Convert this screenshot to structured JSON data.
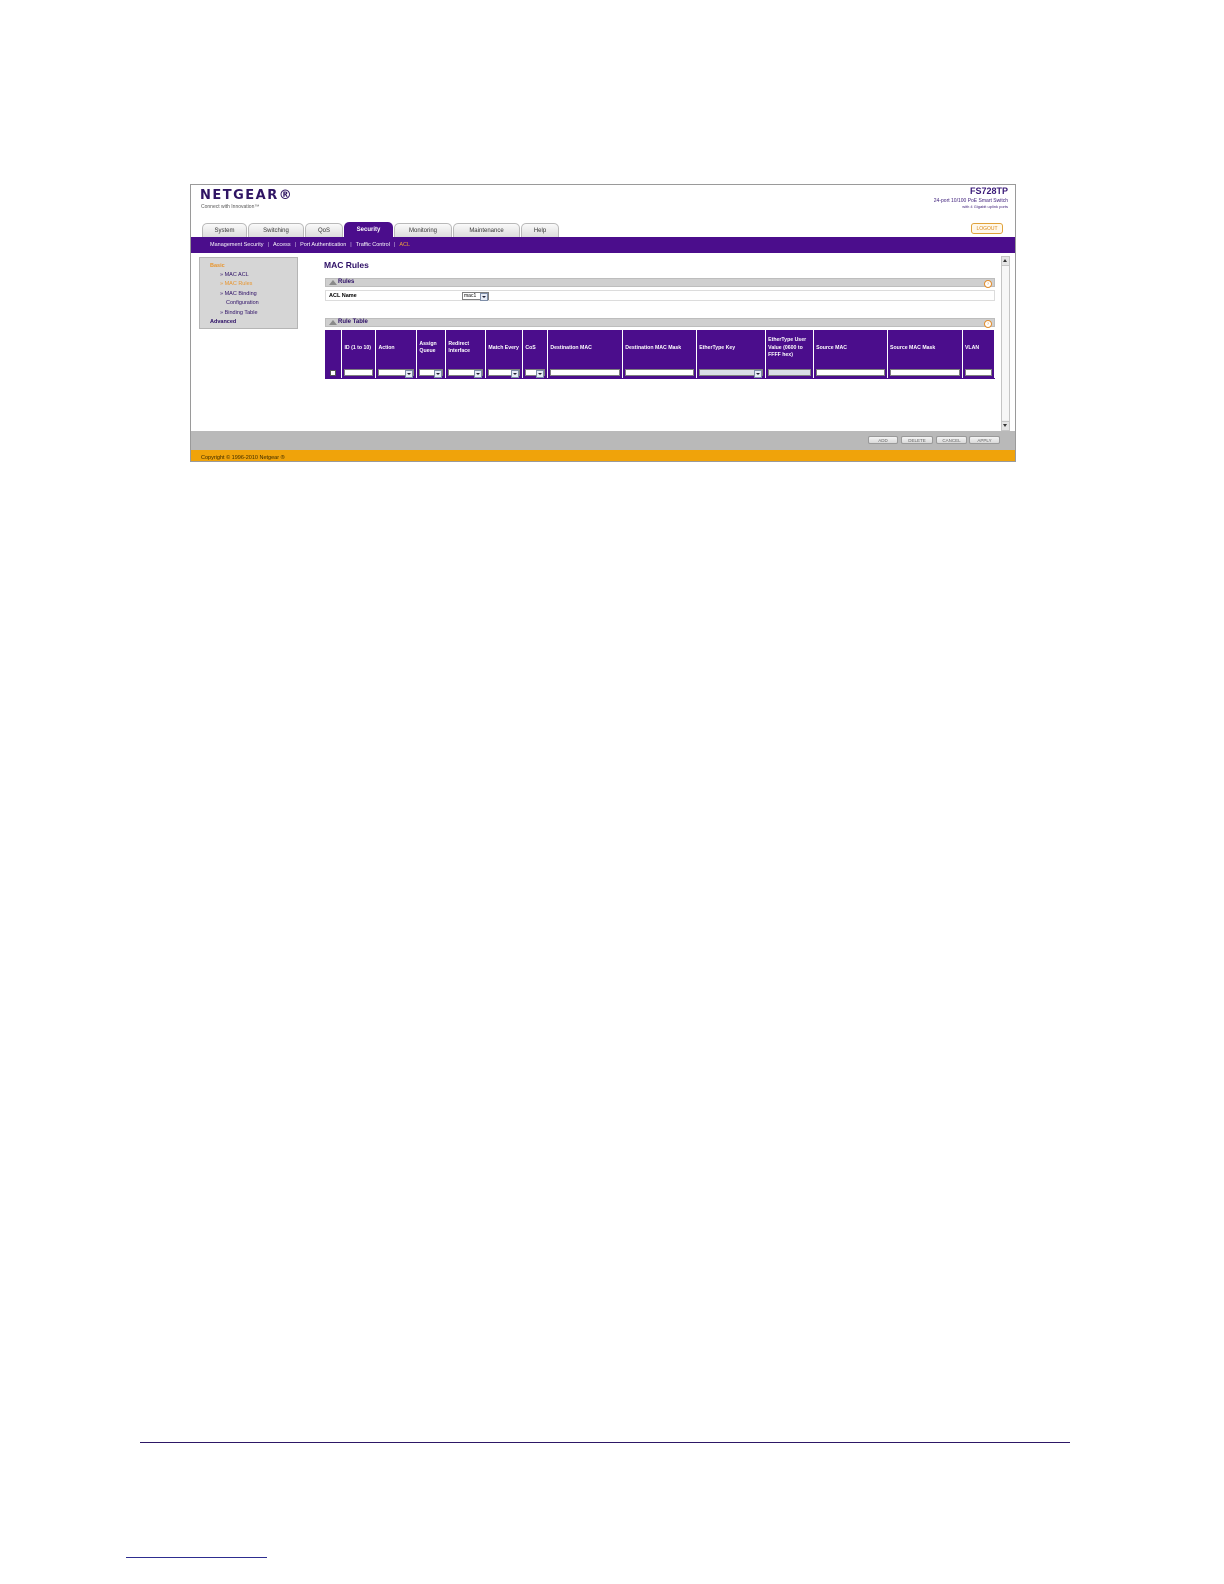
{
  "header": {
    "logo": "NETGEAR®",
    "tagline": "Connect with Innovation™",
    "model": "FS728TP",
    "model_desc_1": "24-port 10/100 PoE Smart Switch",
    "model_desc_2": "with 4 Gigabit uplink ports",
    "logout": "LOGOUT"
  },
  "tabs": [
    {
      "label": "System"
    },
    {
      "label": "Switching"
    },
    {
      "label": "QoS"
    },
    {
      "label": "Security",
      "active": true
    },
    {
      "label": "Monitoring"
    },
    {
      "label": "Maintenance"
    },
    {
      "label": "Help"
    }
  ],
  "subnav": [
    {
      "label": "Management Security"
    },
    {
      "label": "Access"
    },
    {
      "label": "Port Authentication"
    },
    {
      "label": "Traffic Control"
    },
    {
      "label": "ACL",
      "active": true
    }
  ],
  "leftnav": {
    "basic": "Basic",
    "mac_acl": "» MAC ACL",
    "mac_rules": "» MAC Rules",
    "mac_binding_1": "» MAC Binding",
    "mac_binding_2": "Configuration",
    "binding_table": "» Binding Table",
    "advanced": "Advanced"
  },
  "main": {
    "title": "MAC Rules",
    "rules_section": "Rules",
    "acl_name_label": "ACL Name",
    "acl_name_value": "mac1",
    "rule_table_section": "Rule Table"
  },
  "table": {
    "headers": [
      "",
      "ID (1 to 10)",
      "Action",
      "Assign Queue",
      "Redirect Interface",
      "Match Every",
      "CoS",
      "Destination MAC",
      "Destination MAC Mask",
      "EtherType Key",
      "EtherType User Value (0600 to FFFF hex)",
      "Source MAC",
      "Source MAC Mask",
      "VLAN"
    ]
  },
  "buttons": {
    "add": "ADD",
    "delete": "DELETE",
    "cancel": "CANCEL",
    "apply": "APPLY"
  },
  "copyright": "Copyright © 1996-2010 Netgear ®",
  "colors": {
    "brand_purple": "#4b0d8c",
    "accent_orange": "#f0a30a",
    "active_link": "#e8952d"
  }
}
